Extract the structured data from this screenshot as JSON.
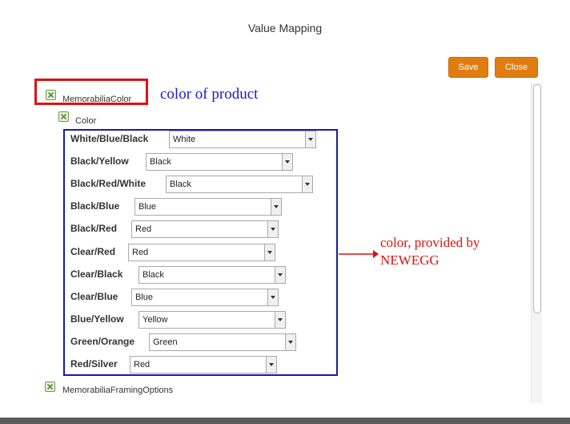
{
  "dialog": {
    "title": "Value Mapping"
  },
  "buttons": {
    "save": "Save",
    "close": "Close"
  },
  "tree": {
    "root": "MemorabiliaColor",
    "child": "Color",
    "next_root": "MemorabiliaFramingOptions"
  },
  "annotations": {
    "product_color": "color of product",
    "provided_color": "color, provided by NEWEGG"
  },
  "mappings": [
    {
      "source": "White/Blue/Black",
      "target": "White"
    },
    {
      "source": "Black/Yellow",
      "target": "Black"
    },
    {
      "source": "Black/Red/White",
      "target": "Black"
    },
    {
      "source": "Black/Blue",
      "target": "Blue"
    },
    {
      "source": "Black/Red",
      "target": "Red"
    },
    {
      "source": "Clear/Red",
      "target": "Red"
    },
    {
      "source": "Clear/Black",
      "target": "Black"
    },
    {
      "source": "Clear/Blue",
      "target": "Blue"
    },
    {
      "source": "Blue/Yellow",
      "target": "Yellow"
    },
    {
      "source": "Green/Orange",
      "target": "Green"
    },
    {
      "source": "Red/Silver",
      "target": "Red"
    }
  ],
  "colors": {
    "button": "#e07d10",
    "highlight_red": "#e01010",
    "highlight_blue": "#1a1aa5",
    "annotation_blue": "#1a1acc",
    "annotation_red": "#dd1111"
  }
}
